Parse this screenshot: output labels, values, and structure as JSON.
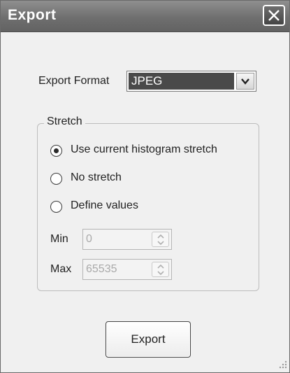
{
  "window": {
    "title": "Export"
  },
  "titlebar": {
    "close_icon": "close-icon"
  },
  "format": {
    "label": "Export Format",
    "selected": "JPEG",
    "arrow_icon": "chevron-down-icon"
  },
  "stretch": {
    "legend": "Stretch",
    "options": [
      {
        "label": "Use current histogram stretch",
        "selected": true
      },
      {
        "label": "No stretch",
        "selected": false
      },
      {
        "label": "Define values",
        "selected": false
      }
    ],
    "min": {
      "label": "Min",
      "value": "0",
      "enabled": false
    },
    "max": {
      "label": "Max",
      "value": "65535",
      "enabled": false
    }
  },
  "actions": {
    "export_label": "Export"
  },
  "colors": {
    "titlebar": "#6f6f6f",
    "selection": "#4a4a4a",
    "panel": "#f0f0f0"
  }
}
